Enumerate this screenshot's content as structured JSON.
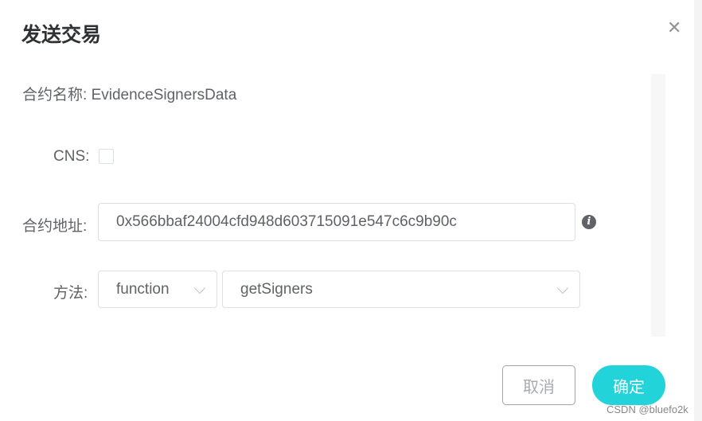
{
  "dialog": {
    "title": "发送交易",
    "close_icon": "close-icon"
  },
  "form": {
    "contract_name_label": "合约名称:",
    "contract_name": "EvidenceSignersData",
    "cns_label": "CNS:",
    "cns_checked": false,
    "address_label": "合约地址:",
    "address_value": "0x566bbaf24004cfd948d603715091e547c6c9b90c",
    "method_label": "方法:",
    "method_type": "function",
    "method_name": "getSigners"
  },
  "buttons": {
    "cancel": "取消",
    "confirm": "确定"
  },
  "colors": {
    "primary": "#22d3d9"
  },
  "watermark": "CSDN @bluefo2k"
}
